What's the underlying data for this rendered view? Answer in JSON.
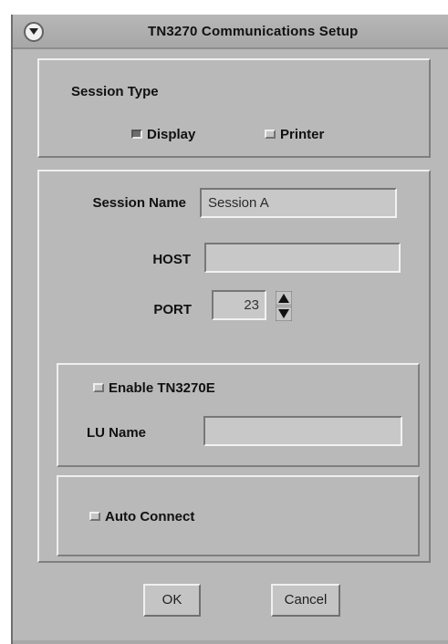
{
  "window": {
    "title": "TN3270 Communications Setup"
  },
  "session_type": {
    "label": "Session Type",
    "options": [
      {
        "label": "Display",
        "selected": true
      },
      {
        "label": "Printer",
        "selected": false
      }
    ]
  },
  "session": {
    "name_label": "Session Name",
    "name_value": "Session A",
    "host_label": "HOST",
    "host_value": "",
    "port_label": "PORT",
    "port_value": "23"
  },
  "tn3270e": {
    "enable_label": "Enable TN3270E",
    "enabled": false,
    "lu_label": "LU Name",
    "lu_value": ""
  },
  "auto_connect": {
    "label": "Auto Connect",
    "enabled": false
  },
  "buttons": {
    "ok": "OK",
    "cancel": "Cancel"
  },
  "colors": {
    "dialog_background": "#b9b9b9",
    "field_background": "#c8c8c8",
    "highlight": "#efefef",
    "shadow": "#7f7f7f"
  },
  "icons": [
    "window-menu-icon",
    "spin-up-icon",
    "spin-down-icon",
    "radio-icon",
    "checkbox-icon"
  ]
}
